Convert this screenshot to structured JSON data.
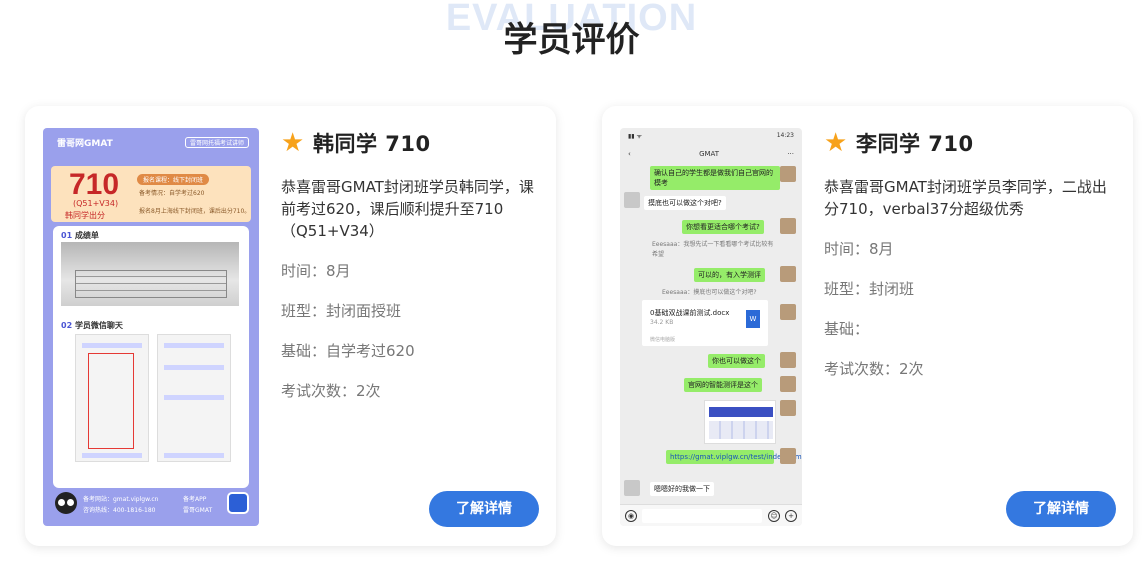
{
  "section": {
    "bg_word": "EVALUATION",
    "title": "学员评价"
  },
  "colors": {
    "accent": "#3478e0",
    "star": "#f7a21b",
    "poster_bg": "#9aa0ec",
    "score_red": "#c62828",
    "chat_green": "#95ec69"
  },
  "cards": [
    {
      "icon": "star-icon",
      "name": "韩同学 710",
      "description": "恭喜雷哥GMAT封闭班学员韩同学，课前考过620，课后顺利提升至710（Q51+V34）",
      "time": "时间：8月",
      "class_type": "班型：封闭面授班",
      "foundation": "基础：自学考过620",
      "attempts": "考试次数：2次",
      "button": "了解详情",
      "poster": {
        "logo": "雷哥网GMAT",
        "tag": "雷哥网托福考试讲师",
        "score": "710",
        "score_sub": "(Q51+V34)",
        "score_name": "韩同学出分",
        "badge": "报名课程：线下封闭班",
        "line1": "备考情况：自学考过620",
        "line2": "报名8月上海线下封闭班，课后出分710。",
        "h1_num": "01",
        "h1": "成绩单",
        "h2_num": "02",
        "h2": "学员微信聊天",
        "foot_l1": "备考网站：gmat.viplgw.cn",
        "foot_l2": "咨询热线：400-1816-180",
        "foot_app": "备考APP",
        "foot_app2": "雷哥GMAT"
      }
    },
    {
      "icon": "star-icon",
      "name": "李同学 710",
      "description": "恭喜雷哥GMAT封闭班学员李同学，二战出分710，verbal37分超级优秀",
      "time": "时间：8月",
      "class_type": "班型：封闭班",
      "foundation": "基础：",
      "attempts": "考试次数：2次",
      "button": "了解详情",
      "phone": {
        "time": "14:23",
        "chat_title": "GMAT",
        "messages": [
          "确认自己的学生都是做我们自己官网的模考",
          "摸底也可以做这个对吧?",
          "你想看更适合哪个考试?",
          "Eeesaaa：我想先试一下看看哪个考试比较有希望",
          "可以的，有入学测评",
          "Eeesaaa：摸底也可以做这个对吧?",
          "你也可以做这个",
          "官网的智能测评是这个",
          "https://gmat.viplgw.cn/test/index.html",
          "嗯嗯好的我做一下"
        ],
        "file_name": "0基础双战课前测试.docx",
        "file_size": "34.2 KB",
        "file_source": "微信电脑版"
      }
    }
  ]
}
